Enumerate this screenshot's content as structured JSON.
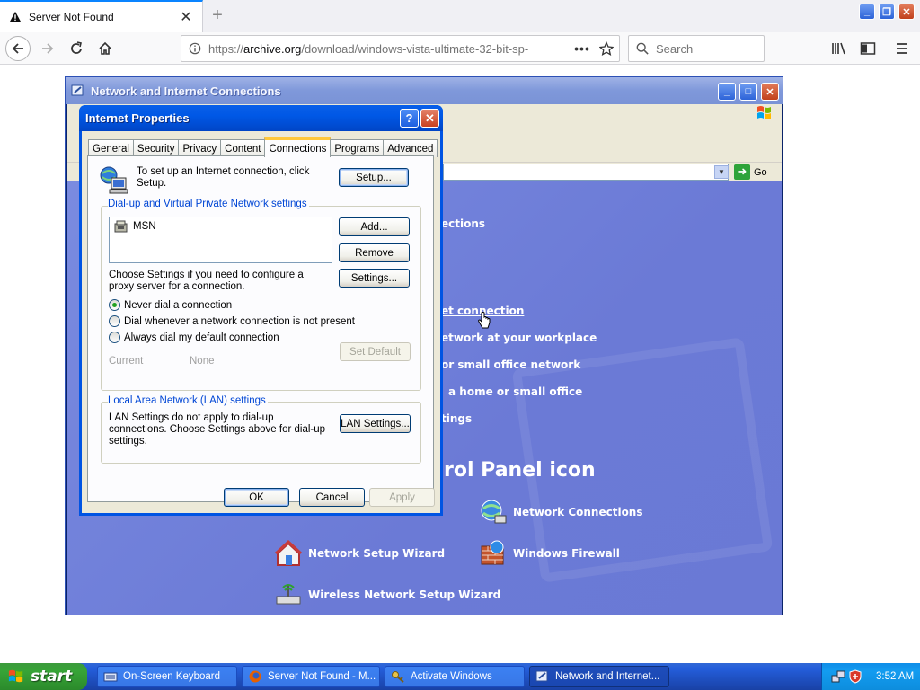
{
  "browser": {
    "tab_title": "Server Not Found",
    "url_prefix": "https://",
    "url_host": "archive.org",
    "url_path": "/download/windows-vista-ultimate-32-bit-sp-",
    "search_placeholder": "Search"
  },
  "cp_window": {
    "title": "Network and Internet Connections",
    "go_label": "Go",
    "links": [
      "ections",
      "et connection",
      "etwork at your workplace",
      "or small office network",
      "a home or small office",
      "tings"
    ],
    "heading": "rol Panel icon",
    "tasks": [
      "Network Connections",
      "Network Setup Wizard",
      "Windows Firewall",
      "Wireless Network Setup Wizard"
    ]
  },
  "dialog": {
    "title": "Internet Properties",
    "tabs": [
      "General",
      "Security",
      "Privacy",
      "Content",
      "Connections",
      "Programs",
      "Advanced"
    ],
    "active_tab": "Connections",
    "setup_text": "To set up an Internet connection, click Setup.",
    "setup_button": "Setup...",
    "dialup_group": "Dial-up and Virtual Private Network settings",
    "connections": [
      "MSN"
    ],
    "add_button": "Add...",
    "remove_button": "Remove",
    "proxy_text": "Choose Settings if you need to configure a proxy server for a connection.",
    "settings_button": "Settings...",
    "radios": [
      {
        "label": "Never dial a connection",
        "checked": true
      },
      {
        "label": "Dial whenever a network connection is not present",
        "checked": false
      },
      {
        "label": "Always dial my default connection",
        "checked": false
      }
    ],
    "current_label": "Current",
    "current_value": "None",
    "set_default_button": "Set Default",
    "lan_group": "Local Area Network (LAN) settings",
    "lan_text": "LAN Settings do not apply to dial-up connections. Choose Settings above for dial-up settings.",
    "lan_button": "LAN Settings...",
    "ok_button": "OK",
    "cancel_button": "Cancel",
    "apply_button": "Apply"
  },
  "taskbar": {
    "start_label": "start",
    "tasks": [
      "On-Screen Keyboard",
      "Server Not Found - M...",
      "Activate Windows",
      "Network and Internet..."
    ],
    "clock": "3:52 AM"
  },
  "colors": {
    "xp_blue": "#0054e3",
    "cp_background": "#7080d8",
    "start_green": "#37a437",
    "dialog_face": "#ece9d8"
  }
}
